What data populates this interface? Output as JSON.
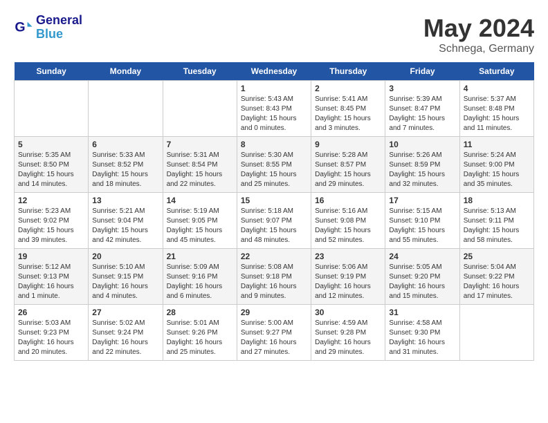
{
  "header": {
    "logo_general": "General",
    "logo_blue": "Blue",
    "month": "May 2024",
    "location": "Schnega, Germany"
  },
  "days_of_week": [
    "Sunday",
    "Monday",
    "Tuesday",
    "Wednesday",
    "Thursday",
    "Friday",
    "Saturday"
  ],
  "weeks": [
    [
      {
        "day": "",
        "info": ""
      },
      {
        "day": "",
        "info": ""
      },
      {
        "day": "",
        "info": ""
      },
      {
        "day": "1",
        "info": "Sunrise: 5:43 AM\nSunset: 8:43 PM\nDaylight: 15 hours\nand 0 minutes."
      },
      {
        "day": "2",
        "info": "Sunrise: 5:41 AM\nSunset: 8:45 PM\nDaylight: 15 hours\nand 3 minutes."
      },
      {
        "day": "3",
        "info": "Sunrise: 5:39 AM\nSunset: 8:47 PM\nDaylight: 15 hours\nand 7 minutes."
      },
      {
        "day": "4",
        "info": "Sunrise: 5:37 AM\nSunset: 8:48 PM\nDaylight: 15 hours\nand 11 minutes."
      }
    ],
    [
      {
        "day": "5",
        "info": "Sunrise: 5:35 AM\nSunset: 8:50 PM\nDaylight: 15 hours\nand 14 minutes."
      },
      {
        "day": "6",
        "info": "Sunrise: 5:33 AM\nSunset: 8:52 PM\nDaylight: 15 hours\nand 18 minutes."
      },
      {
        "day": "7",
        "info": "Sunrise: 5:31 AM\nSunset: 8:54 PM\nDaylight: 15 hours\nand 22 minutes."
      },
      {
        "day": "8",
        "info": "Sunrise: 5:30 AM\nSunset: 8:55 PM\nDaylight: 15 hours\nand 25 minutes."
      },
      {
        "day": "9",
        "info": "Sunrise: 5:28 AM\nSunset: 8:57 PM\nDaylight: 15 hours\nand 29 minutes."
      },
      {
        "day": "10",
        "info": "Sunrise: 5:26 AM\nSunset: 8:59 PM\nDaylight: 15 hours\nand 32 minutes."
      },
      {
        "day": "11",
        "info": "Sunrise: 5:24 AM\nSunset: 9:00 PM\nDaylight: 15 hours\nand 35 minutes."
      }
    ],
    [
      {
        "day": "12",
        "info": "Sunrise: 5:23 AM\nSunset: 9:02 PM\nDaylight: 15 hours\nand 39 minutes."
      },
      {
        "day": "13",
        "info": "Sunrise: 5:21 AM\nSunset: 9:04 PM\nDaylight: 15 hours\nand 42 minutes."
      },
      {
        "day": "14",
        "info": "Sunrise: 5:19 AM\nSunset: 9:05 PM\nDaylight: 15 hours\nand 45 minutes."
      },
      {
        "day": "15",
        "info": "Sunrise: 5:18 AM\nSunset: 9:07 PM\nDaylight: 15 hours\nand 48 minutes."
      },
      {
        "day": "16",
        "info": "Sunrise: 5:16 AM\nSunset: 9:08 PM\nDaylight: 15 hours\nand 52 minutes."
      },
      {
        "day": "17",
        "info": "Sunrise: 5:15 AM\nSunset: 9:10 PM\nDaylight: 15 hours\nand 55 minutes."
      },
      {
        "day": "18",
        "info": "Sunrise: 5:13 AM\nSunset: 9:11 PM\nDaylight: 15 hours\nand 58 minutes."
      }
    ],
    [
      {
        "day": "19",
        "info": "Sunrise: 5:12 AM\nSunset: 9:13 PM\nDaylight: 16 hours\nand 1 minute."
      },
      {
        "day": "20",
        "info": "Sunrise: 5:10 AM\nSunset: 9:15 PM\nDaylight: 16 hours\nand 4 minutes."
      },
      {
        "day": "21",
        "info": "Sunrise: 5:09 AM\nSunset: 9:16 PM\nDaylight: 16 hours\nand 6 minutes."
      },
      {
        "day": "22",
        "info": "Sunrise: 5:08 AM\nSunset: 9:18 PM\nDaylight: 16 hours\nand 9 minutes."
      },
      {
        "day": "23",
        "info": "Sunrise: 5:06 AM\nSunset: 9:19 PM\nDaylight: 16 hours\nand 12 minutes."
      },
      {
        "day": "24",
        "info": "Sunrise: 5:05 AM\nSunset: 9:20 PM\nDaylight: 16 hours\nand 15 minutes."
      },
      {
        "day": "25",
        "info": "Sunrise: 5:04 AM\nSunset: 9:22 PM\nDaylight: 16 hours\nand 17 minutes."
      }
    ],
    [
      {
        "day": "26",
        "info": "Sunrise: 5:03 AM\nSunset: 9:23 PM\nDaylight: 16 hours\nand 20 minutes."
      },
      {
        "day": "27",
        "info": "Sunrise: 5:02 AM\nSunset: 9:24 PM\nDaylight: 16 hours\nand 22 minutes."
      },
      {
        "day": "28",
        "info": "Sunrise: 5:01 AM\nSunset: 9:26 PM\nDaylight: 16 hours\nand 25 minutes."
      },
      {
        "day": "29",
        "info": "Sunrise: 5:00 AM\nSunset: 9:27 PM\nDaylight: 16 hours\nand 27 minutes."
      },
      {
        "day": "30",
        "info": "Sunrise: 4:59 AM\nSunset: 9:28 PM\nDaylight: 16 hours\nand 29 minutes."
      },
      {
        "day": "31",
        "info": "Sunrise: 4:58 AM\nSunset: 9:30 PM\nDaylight: 16 hours\nand 31 minutes."
      },
      {
        "day": "",
        "info": ""
      }
    ]
  ]
}
